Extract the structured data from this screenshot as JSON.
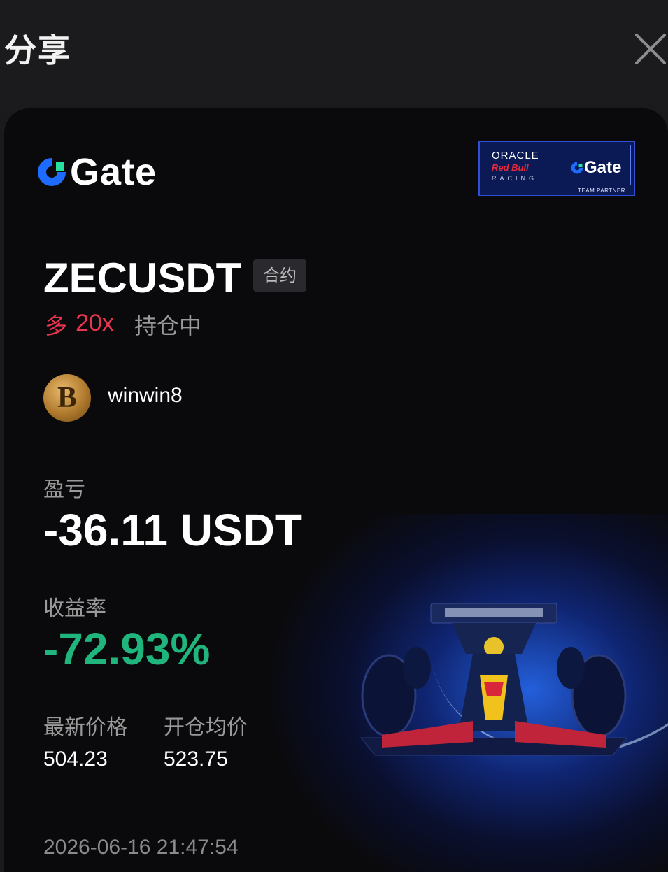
{
  "header": {
    "title": "分享"
  },
  "icons": {
    "close": "close-icon",
    "logo": "gate-logo-icon",
    "avatar": "bitcoin-avatar-icon",
    "car": "f1-car-image"
  },
  "brand": {
    "name": "Gate",
    "accent": "#1e6bff"
  },
  "partner_badge": {
    "line1": "ORACLE",
    "line2": "Red Bull",
    "line3": "RACING",
    "brand": "Gate",
    "footer": "TEAM PARTNER"
  },
  "position": {
    "pair": "ZECUSDT",
    "contract_tag": "合约",
    "direction": "多",
    "leverage": "20x",
    "status": "持仓中",
    "direction_color": "#e8354f"
  },
  "user": {
    "avatar_glyph": "B",
    "username": "winwin8"
  },
  "pnl": {
    "label": "盈亏",
    "value": "-36.11 USDT"
  },
  "roi": {
    "label": "收益率",
    "value": "-72.93%",
    "color": "#1fb57c"
  },
  "prices": {
    "latest_label": "最新价格",
    "latest_value": "504.23",
    "entry_label": "开仓均价",
    "entry_value": "523.75"
  },
  "timestamp": "2026-06-16 21:47:54"
}
